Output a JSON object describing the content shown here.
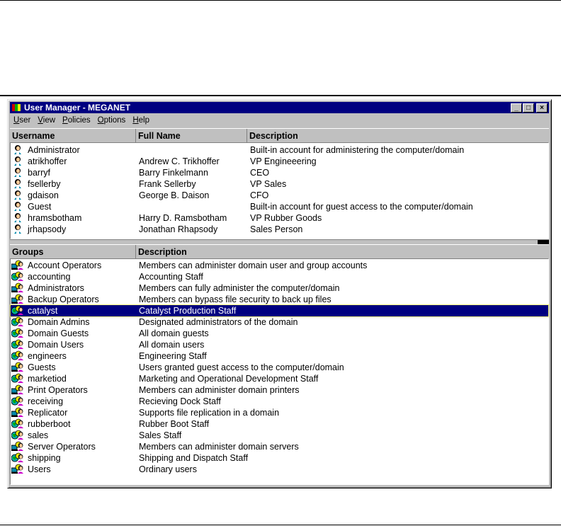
{
  "window": {
    "title": "User Manager - MEGANET",
    "minimize": "_",
    "maximize": "□",
    "close": "×"
  },
  "menu": [
    "User",
    "View",
    "Policies",
    "Options",
    "Help"
  ],
  "users": {
    "headers": [
      "Username",
      "Full Name",
      "Description"
    ],
    "rows": [
      [
        "Administrator",
        "",
        "Built-in account for administering the computer/domain"
      ],
      [
        "atrikhoffer",
        "Andrew C. Trikhoffer",
        "VP Engineeering"
      ],
      [
        "barryf",
        "Barry Finkelmann",
        "CEO"
      ],
      [
        "fsellerby",
        "Frank Sellerby",
        "VP Sales"
      ],
      [
        "gdaison",
        "George B. Daison",
        "CFO"
      ],
      [
        "Guest",
        "",
        "Built-in account for guest access to the computer/domain"
      ],
      [
        "hramsbotham",
        "Harry D. Ramsbotham",
        "VP Rubber Goods"
      ],
      [
        "jrhapsody",
        "Jonathan Rhapsody",
        "Sales Person"
      ]
    ]
  },
  "groups": {
    "headers": [
      "Groups",
      "Description"
    ],
    "selected": "catalyst",
    "rows": [
      [
        "Account Operators",
        "Members can administer domain user and group accounts",
        "local"
      ],
      [
        "accounting",
        "Accounting Staff",
        "global"
      ],
      [
        "Administrators",
        "Members can fully administer the computer/domain",
        "local"
      ],
      [
        "Backup Operators",
        "Members can bypass file security to back up files",
        "local"
      ],
      [
        "catalyst",
        "Catalyst Production Staff",
        "global"
      ],
      [
        "Domain Admins",
        "Designated administrators of the domain",
        "global"
      ],
      [
        "Domain Guests",
        "All domain guests",
        "global"
      ],
      [
        "Domain Users",
        "All domain users",
        "global"
      ],
      [
        "engineers",
        "Engineering Staff",
        "global"
      ],
      [
        "Guests",
        "Users granted guest access to the computer/domain",
        "local"
      ],
      [
        "marketiod",
        "Marketing and Operational Development Staff",
        "global"
      ],
      [
        "Print Operators",
        "Members can administer domain printers",
        "local"
      ],
      [
        "receiving",
        "Recieving Dock Staff",
        "global"
      ],
      [
        "Replicator",
        "Supports file replication in a domain",
        "local"
      ],
      [
        "rubberboot",
        "Rubber Boot Staff",
        "global"
      ],
      [
        "sales",
        "Sales Staff",
        "global"
      ],
      [
        "Server Operators",
        "Members can administer domain servers",
        "local"
      ],
      [
        "shipping",
        "Shipping and Dispatch Staff",
        "global"
      ],
      [
        "Users",
        "Ordinary users",
        "local"
      ]
    ]
  }
}
